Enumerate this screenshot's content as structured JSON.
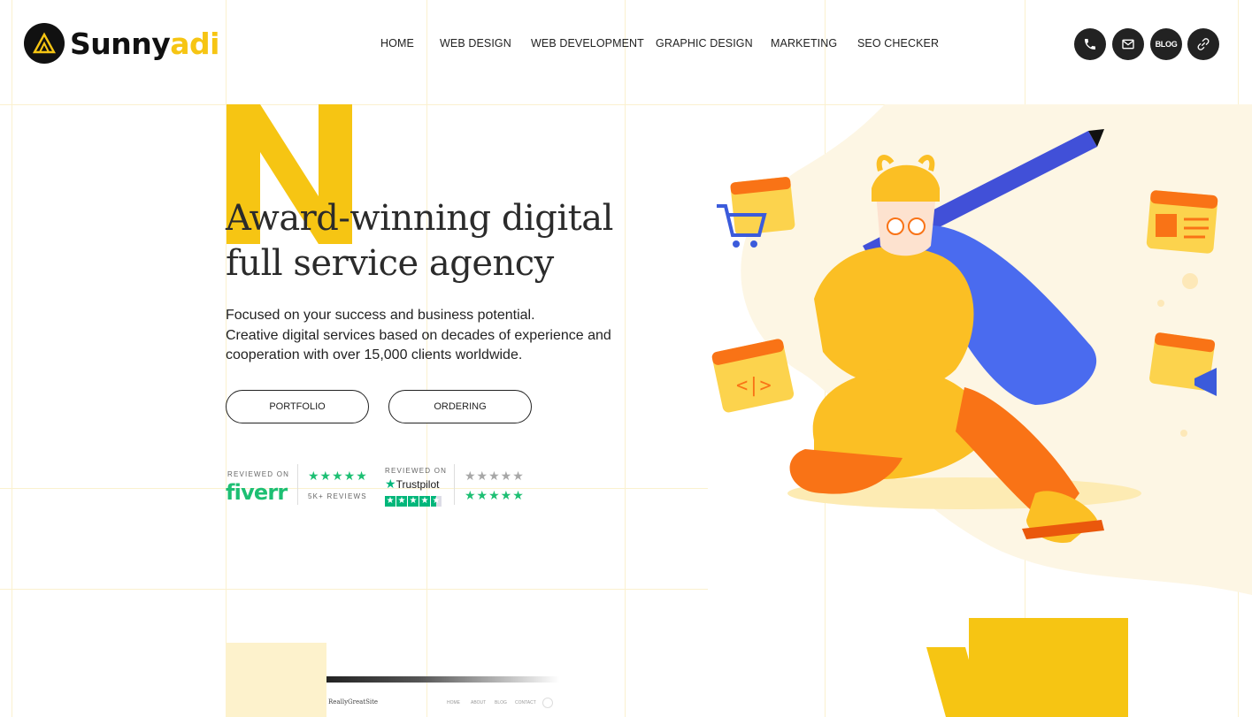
{
  "brand": {
    "name_part1": "Sunny",
    "name_part2": "adi"
  },
  "nav": {
    "items": [
      "HOME",
      "WEB DESIGN",
      "WEB DEVELOPMENT",
      "GRAPHIC DESIGN",
      "MARKETING",
      "SEO CHECKER"
    ]
  },
  "header_actions": {
    "blog_label": "BLOG",
    "icons": [
      "phone-icon",
      "mail-icon",
      "blog-icon",
      "link-icon"
    ]
  },
  "hero": {
    "big_letter": "N",
    "headline_line1": "Award-winning digital",
    "headline_line2": "full service agency",
    "desc_line1": "Focused on your success and business potential.",
    "desc_line2": "Creative digital services based on decades of experience and",
    "desc_line3": "cooperation with over 15,000 clients worldwide.",
    "btn_portfolio": "PORTFOLIO",
    "btn_ordering": "ORDERING"
  },
  "reviews": {
    "fiverr_reviewed_on": "REVIEWED ON",
    "fiverr_name": "fiverr",
    "fiverr_stars": "★★★★★",
    "fiverr_count": "5K+ REVIEWS",
    "trustpilot_reviewed_on": "REVIEWED ON",
    "trustpilot_name": "Trustpilot",
    "rating_row1": "★★★★★",
    "rating_row2": "★★★★★"
  },
  "preview": {
    "logo": "ReallyGreatSite",
    "nav": [
      "HOME",
      "ABOUT",
      "BLOG",
      "CONTACT"
    ]
  },
  "colors": {
    "brand_yellow": "#f6c513",
    "text_dark": "#222222",
    "fiverr_green": "#1dbf73",
    "trustpilot_green": "#00b67a"
  }
}
